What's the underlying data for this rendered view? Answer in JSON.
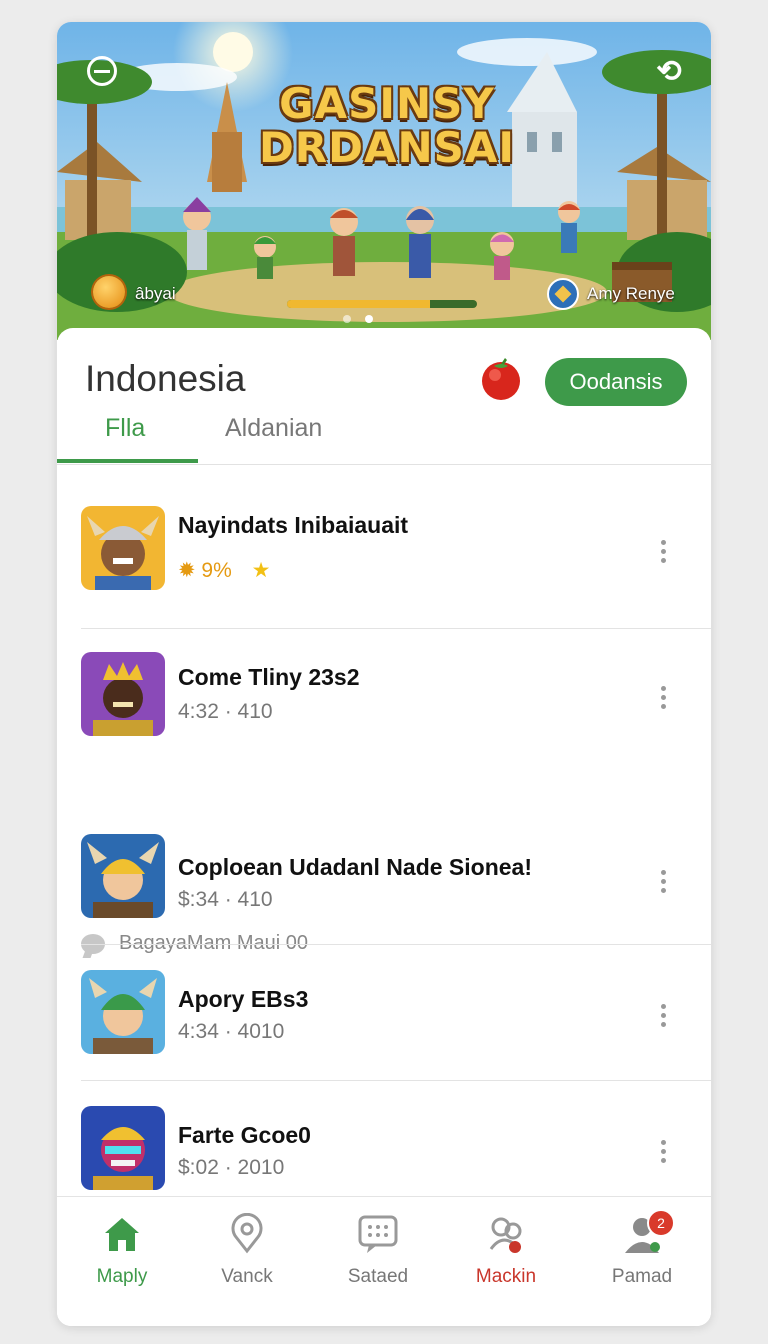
{
  "banner": {
    "title_line1": "GASINSY",
    "title_line2": "DRDANSAI",
    "left_label": "âbyai",
    "right_label": "Amy Renye",
    "progress": 0.75,
    "slides": 2,
    "active_slide": 1
  },
  "header": {
    "title": "Indonesia",
    "action_button": "Oodansis",
    "tabs": [
      {
        "label": "Flla",
        "active": true
      },
      {
        "label": "Aldanian",
        "active": false
      }
    ]
  },
  "list": {
    "items": [
      {
        "title": "Nayindats Inibaiauait",
        "rating_text": "✹ 9%",
        "star": "★"
      },
      {
        "title": "Come Tliny 23s2",
        "subtitle": "4:32 · 410"
      },
      {
        "title": "Coploean Udadanl Nade Sionea!",
        "subtitle": "$:34 · 410"
      },
      {
        "title": "Apory EBs3",
        "subtitle": "4:34 · 4010"
      },
      {
        "title": "Farte Gcoe0",
        "subtitle": "$:02 · 2010"
      }
    ],
    "section_label": "BagayaMam Maui 00"
  },
  "nav": {
    "items": [
      {
        "label": "Maply",
        "icon": "home-icon"
      },
      {
        "label": "Vanck",
        "icon": "location-icon"
      },
      {
        "label": "Sataed",
        "icon": "chat-icon"
      },
      {
        "label": "Mackin",
        "icon": "group-icon"
      },
      {
        "label": "Pamad",
        "icon": "profile-icon"
      }
    ],
    "notification_count": "2"
  },
  "colors": {
    "accent": "#3e9a4a",
    "alert": "#c9362b"
  }
}
